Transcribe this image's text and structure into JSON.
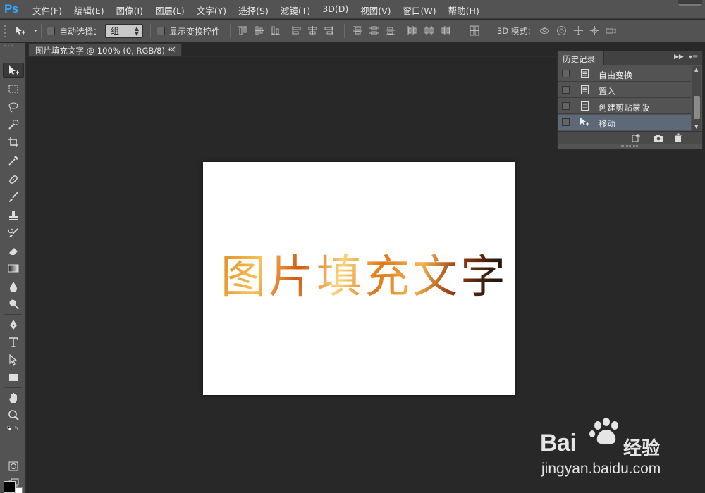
{
  "app": {
    "logo": "Ps",
    "menu": [
      "文件(F)",
      "编辑(E)",
      "图像(I)",
      "图层(L)",
      "文字(Y)",
      "选择(S)",
      "滤镜(T)",
      "3D(D)",
      "视图(V)",
      "窗口(W)",
      "帮助(H)"
    ]
  },
  "options_bar": {
    "auto_select_label": "自动选择：",
    "auto_select_value": "组",
    "show_transform_label": "显示变换控件",
    "mode_3d_label": "3D 模式："
  },
  "document": {
    "tab_title": "图片填充文字 @ 100% (0, RGB/8) *",
    "tab_close": "×",
    "canvas_text": "图片填充文字"
  },
  "history_panel": {
    "title": "历史记录",
    "items": [
      {
        "label": "自由变换",
        "icon": "document-icon",
        "selected": false
      },
      {
        "label": "置入",
        "icon": "document-icon",
        "selected": false
      },
      {
        "label": "创建剪贴蒙版",
        "icon": "document-icon",
        "selected": false
      },
      {
        "label": "移动",
        "icon": "move-tool-icon",
        "selected": true
      }
    ]
  },
  "colors": {
    "foreground": "#000000",
    "background": "#ffffff",
    "accent": "#31a8ff",
    "selection": "#5d6878"
  },
  "watermark": {
    "brand": "Bai",
    "brand_suffix": "du",
    "product": "经验",
    "url": "jingyan.baidu.com"
  }
}
